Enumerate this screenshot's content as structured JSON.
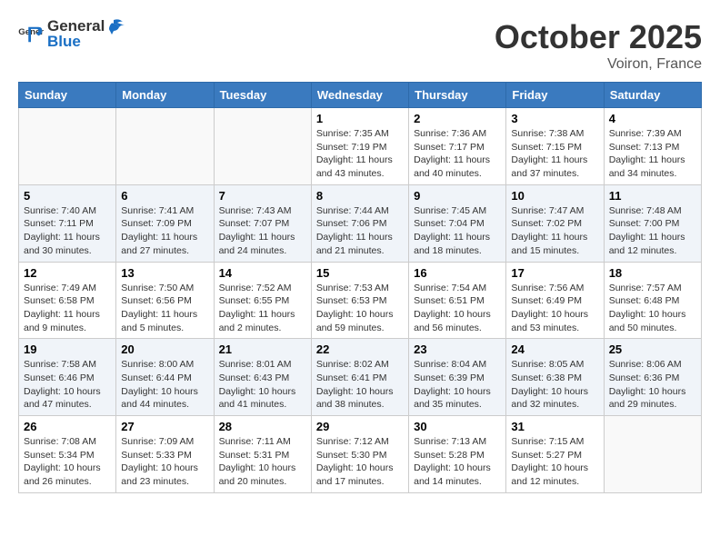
{
  "header": {
    "logo_general": "General",
    "logo_blue": "Blue",
    "month": "October 2025",
    "location": "Voiron, France"
  },
  "weekdays": [
    "Sunday",
    "Monday",
    "Tuesday",
    "Wednesday",
    "Thursday",
    "Friday",
    "Saturday"
  ],
  "weeks": [
    [
      {
        "day": "",
        "info": ""
      },
      {
        "day": "",
        "info": ""
      },
      {
        "day": "",
        "info": ""
      },
      {
        "day": "1",
        "info": "Sunrise: 7:35 AM\nSunset: 7:19 PM\nDaylight: 11 hours\nand 43 minutes."
      },
      {
        "day": "2",
        "info": "Sunrise: 7:36 AM\nSunset: 7:17 PM\nDaylight: 11 hours\nand 40 minutes."
      },
      {
        "day": "3",
        "info": "Sunrise: 7:38 AM\nSunset: 7:15 PM\nDaylight: 11 hours\nand 37 minutes."
      },
      {
        "day": "4",
        "info": "Sunrise: 7:39 AM\nSunset: 7:13 PM\nDaylight: 11 hours\nand 34 minutes."
      }
    ],
    [
      {
        "day": "5",
        "info": "Sunrise: 7:40 AM\nSunset: 7:11 PM\nDaylight: 11 hours\nand 30 minutes."
      },
      {
        "day": "6",
        "info": "Sunrise: 7:41 AM\nSunset: 7:09 PM\nDaylight: 11 hours\nand 27 minutes."
      },
      {
        "day": "7",
        "info": "Sunrise: 7:43 AM\nSunset: 7:07 PM\nDaylight: 11 hours\nand 24 minutes."
      },
      {
        "day": "8",
        "info": "Sunrise: 7:44 AM\nSunset: 7:06 PM\nDaylight: 11 hours\nand 21 minutes."
      },
      {
        "day": "9",
        "info": "Sunrise: 7:45 AM\nSunset: 7:04 PM\nDaylight: 11 hours\nand 18 minutes."
      },
      {
        "day": "10",
        "info": "Sunrise: 7:47 AM\nSunset: 7:02 PM\nDaylight: 11 hours\nand 15 minutes."
      },
      {
        "day": "11",
        "info": "Sunrise: 7:48 AM\nSunset: 7:00 PM\nDaylight: 11 hours\nand 12 minutes."
      }
    ],
    [
      {
        "day": "12",
        "info": "Sunrise: 7:49 AM\nSunset: 6:58 PM\nDaylight: 11 hours\nand 9 minutes."
      },
      {
        "day": "13",
        "info": "Sunrise: 7:50 AM\nSunset: 6:56 PM\nDaylight: 11 hours\nand 5 minutes."
      },
      {
        "day": "14",
        "info": "Sunrise: 7:52 AM\nSunset: 6:55 PM\nDaylight: 11 hours\nand 2 minutes."
      },
      {
        "day": "15",
        "info": "Sunrise: 7:53 AM\nSunset: 6:53 PM\nDaylight: 10 hours\nand 59 minutes."
      },
      {
        "day": "16",
        "info": "Sunrise: 7:54 AM\nSunset: 6:51 PM\nDaylight: 10 hours\nand 56 minutes."
      },
      {
        "day": "17",
        "info": "Sunrise: 7:56 AM\nSunset: 6:49 PM\nDaylight: 10 hours\nand 53 minutes."
      },
      {
        "day": "18",
        "info": "Sunrise: 7:57 AM\nSunset: 6:48 PM\nDaylight: 10 hours\nand 50 minutes."
      }
    ],
    [
      {
        "day": "19",
        "info": "Sunrise: 7:58 AM\nSunset: 6:46 PM\nDaylight: 10 hours\nand 47 minutes."
      },
      {
        "day": "20",
        "info": "Sunrise: 8:00 AM\nSunset: 6:44 PM\nDaylight: 10 hours\nand 44 minutes."
      },
      {
        "day": "21",
        "info": "Sunrise: 8:01 AM\nSunset: 6:43 PM\nDaylight: 10 hours\nand 41 minutes."
      },
      {
        "day": "22",
        "info": "Sunrise: 8:02 AM\nSunset: 6:41 PM\nDaylight: 10 hours\nand 38 minutes."
      },
      {
        "day": "23",
        "info": "Sunrise: 8:04 AM\nSunset: 6:39 PM\nDaylight: 10 hours\nand 35 minutes."
      },
      {
        "day": "24",
        "info": "Sunrise: 8:05 AM\nSunset: 6:38 PM\nDaylight: 10 hours\nand 32 minutes."
      },
      {
        "day": "25",
        "info": "Sunrise: 8:06 AM\nSunset: 6:36 PM\nDaylight: 10 hours\nand 29 minutes."
      }
    ],
    [
      {
        "day": "26",
        "info": "Sunrise: 7:08 AM\nSunset: 5:34 PM\nDaylight: 10 hours\nand 26 minutes."
      },
      {
        "day": "27",
        "info": "Sunrise: 7:09 AM\nSunset: 5:33 PM\nDaylight: 10 hours\nand 23 minutes."
      },
      {
        "day": "28",
        "info": "Sunrise: 7:11 AM\nSunset: 5:31 PM\nDaylight: 10 hours\nand 20 minutes."
      },
      {
        "day": "29",
        "info": "Sunrise: 7:12 AM\nSunset: 5:30 PM\nDaylight: 10 hours\nand 17 minutes."
      },
      {
        "day": "30",
        "info": "Sunrise: 7:13 AM\nSunset: 5:28 PM\nDaylight: 10 hours\nand 14 minutes."
      },
      {
        "day": "31",
        "info": "Sunrise: 7:15 AM\nSunset: 5:27 PM\nDaylight: 10 hours\nand 12 minutes."
      },
      {
        "day": "",
        "info": ""
      }
    ]
  ]
}
